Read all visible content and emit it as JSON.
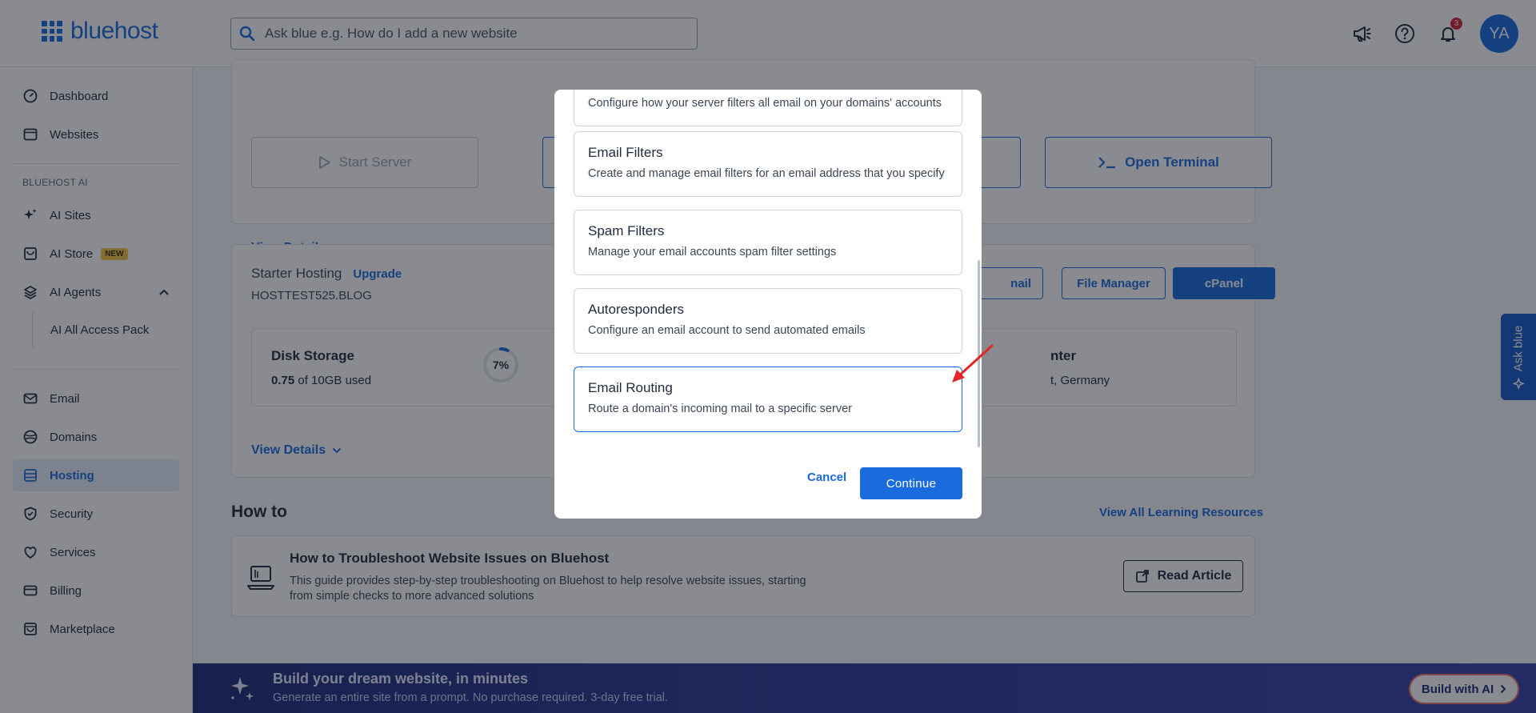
{
  "header": {
    "brand": "bluehost",
    "search_placeholder": "Ask blue e.g. How do I add a new website",
    "notification_count": "3",
    "avatar_initials": "YA"
  },
  "sidebar": {
    "items_top": [
      {
        "label": "Dashboard"
      },
      {
        "label": "Websites"
      }
    ],
    "ai_section_label": "BLUEHOST AI",
    "ai_items": [
      {
        "label": "AI Sites"
      },
      {
        "label": "AI Store",
        "badge": "NEW"
      },
      {
        "label": "AI Agents"
      }
    ],
    "ai_sub_item": "AI All Access Pack",
    "items_bottom": [
      {
        "label": "Email"
      },
      {
        "label": "Domains"
      },
      {
        "label": "Hosting",
        "active": true
      },
      {
        "label": "Security"
      },
      {
        "label": "Services"
      },
      {
        "label": "Billing"
      },
      {
        "label": "Marketplace"
      }
    ]
  },
  "main": {
    "server_card": {
      "start_server": "Start Server",
      "open_terminal": "Open Terminal",
      "view_details": "View Details"
    },
    "hosting_card": {
      "plan": "Starter Hosting",
      "upgrade": "Upgrade",
      "domain": "HOSTTEST525.BLOG",
      "email_btn_partial": "nail",
      "file_manager": "File Manager",
      "cpanel": "cPanel",
      "disk_title": "Disk Storage",
      "disk_used_value": "0.75",
      "disk_used_rest": " of 10GB used",
      "disk_percent": "7%",
      "disk_fraction": 0.07,
      "datacenter_title_partial": "nter",
      "datacenter_value_partial": "t, Germany",
      "view_details": "View Details"
    },
    "howto": {
      "title": "How to",
      "view_all": "View All Learning Resources",
      "article_title": "How to Troubleshoot Website Issues on Bluehost",
      "article_desc_line1": "This guide provides step-by-step troubleshooting on Bluehost to help resolve website issues, starting",
      "article_desc_line2": "from simple checks to more advanced solutions",
      "read_article": "Read Article"
    },
    "banner": {
      "title": "Build your dream website, in minutes",
      "subtitle": "Generate an entire site from a prompt. No purchase required. 3-day free trial.",
      "cta": "Build with AI"
    },
    "ask_blue": "Ask blue"
  },
  "modal": {
    "partial_desc": "Configure how your server filters all email on your domains' accounts",
    "options": [
      {
        "title": "Email Filters",
        "desc": "Create and manage email filters for an email address that you specify"
      },
      {
        "title": "Spam Filters",
        "desc": "Manage your email accounts spam filter settings"
      },
      {
        "title": "Autoresponders",
        "desc": "Configure an email account to send automated emails"
      },
      {
        "title": "Email Routing",
        "desc": "Route a domain's incoming mail to a specific server",
        "selected": true
      }
    ],
    "cancel": "Cancel",
    "continue": "Continue"
  },
  "colors": {
    "brand": "#196bde",
    "badge_red": "#d5203a",
    "new_badge": "#f5c542",
    "banner": "#1b2a78",
    "annotation_arrow": "#e32626"
  }
}
